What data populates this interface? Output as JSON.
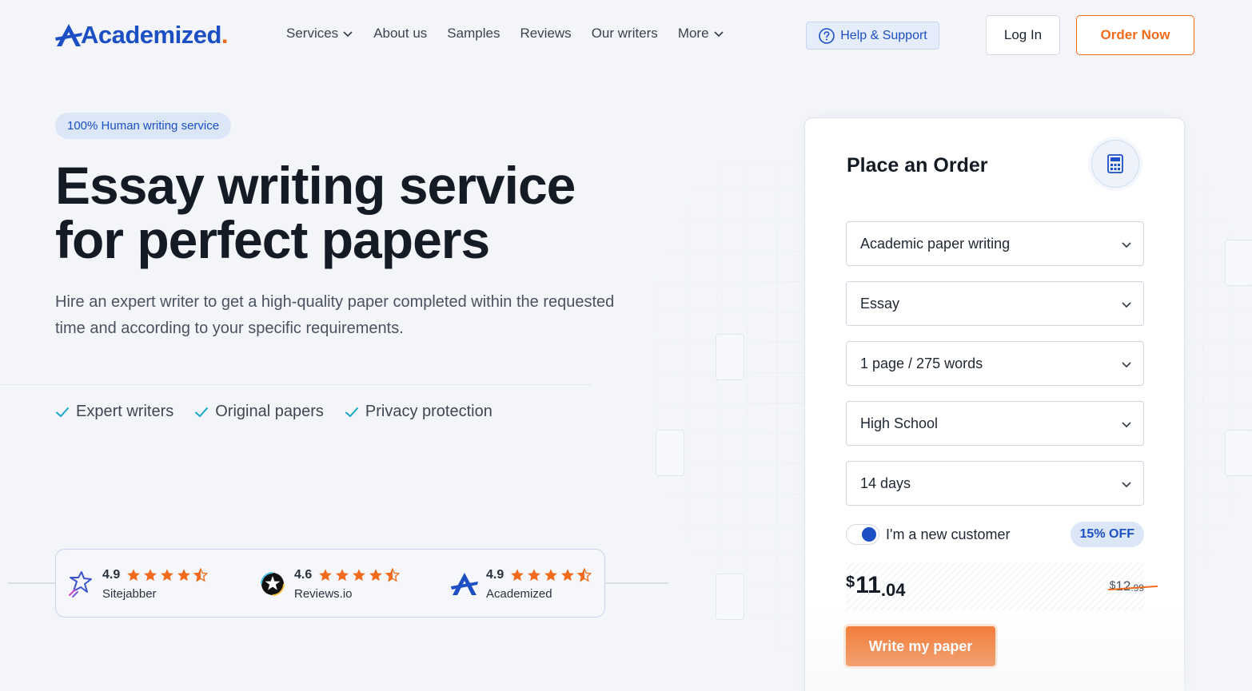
{
  "brand": {
    "name": "Academized",
    "dot": ".",
    "accent": "#1d4fc4",
    "orange": "#f26a1b"
  },
  "nav": {
    "services": "Services",
    "about": "About us",
    "samples": "Samples",
    "reviews": "Reviews",
    "writers": "Our writers",
    "more": "More"
  },
  "header": {
    "help": "Help & Support",
    "login": "Log In",
    "order": "Order Now"
  },
  "hero": {
    "badge": "100% Human writing service",
    "title_line1": "Essay writing service",
    "title_line2": "for perfect papers",
    "subtitle": "Hire an expert writer to get a high-quality paper completed within the requested time and according to your specific requirements.",
    "features": [
      "Expert writers",
      "Original papers",
      "Privacy protection"
    ]
  },
  "ratings": [
    {
      "score": "4.9",
      "name": "Sitejabber",
      "stars": 4.5,
      "icon": "sitejabber-icon"
    },
    {
      "score": "4.6",
      "name": "Reviews.io",
      "stars": 4.5,
      "icon": "reviews-io-icon"
    },
    {
      "score": "4.9",
      "name": "Academized",
      "stars": 4.5,
      "icon": "academized-icon"
    }
  ],
  "order": {
    "title": "Place an Order",
    "service": "Academic paper writing",
    "type": "Essay",
    "pages": "1 page / 275 words",
    "level": "High School",
    "deadline": "14 days",
    "new_customer_label": "I'm a new customer",
    "discount": "15% OFF",
    "price_symbol": "$",
    "price_int": "11",
    "price_dec": ".04",
    "old_symbol": "$",
    "old_int": "12",
    "old_dec": ".99",
    "submit": "Write my paper"
  }
}
